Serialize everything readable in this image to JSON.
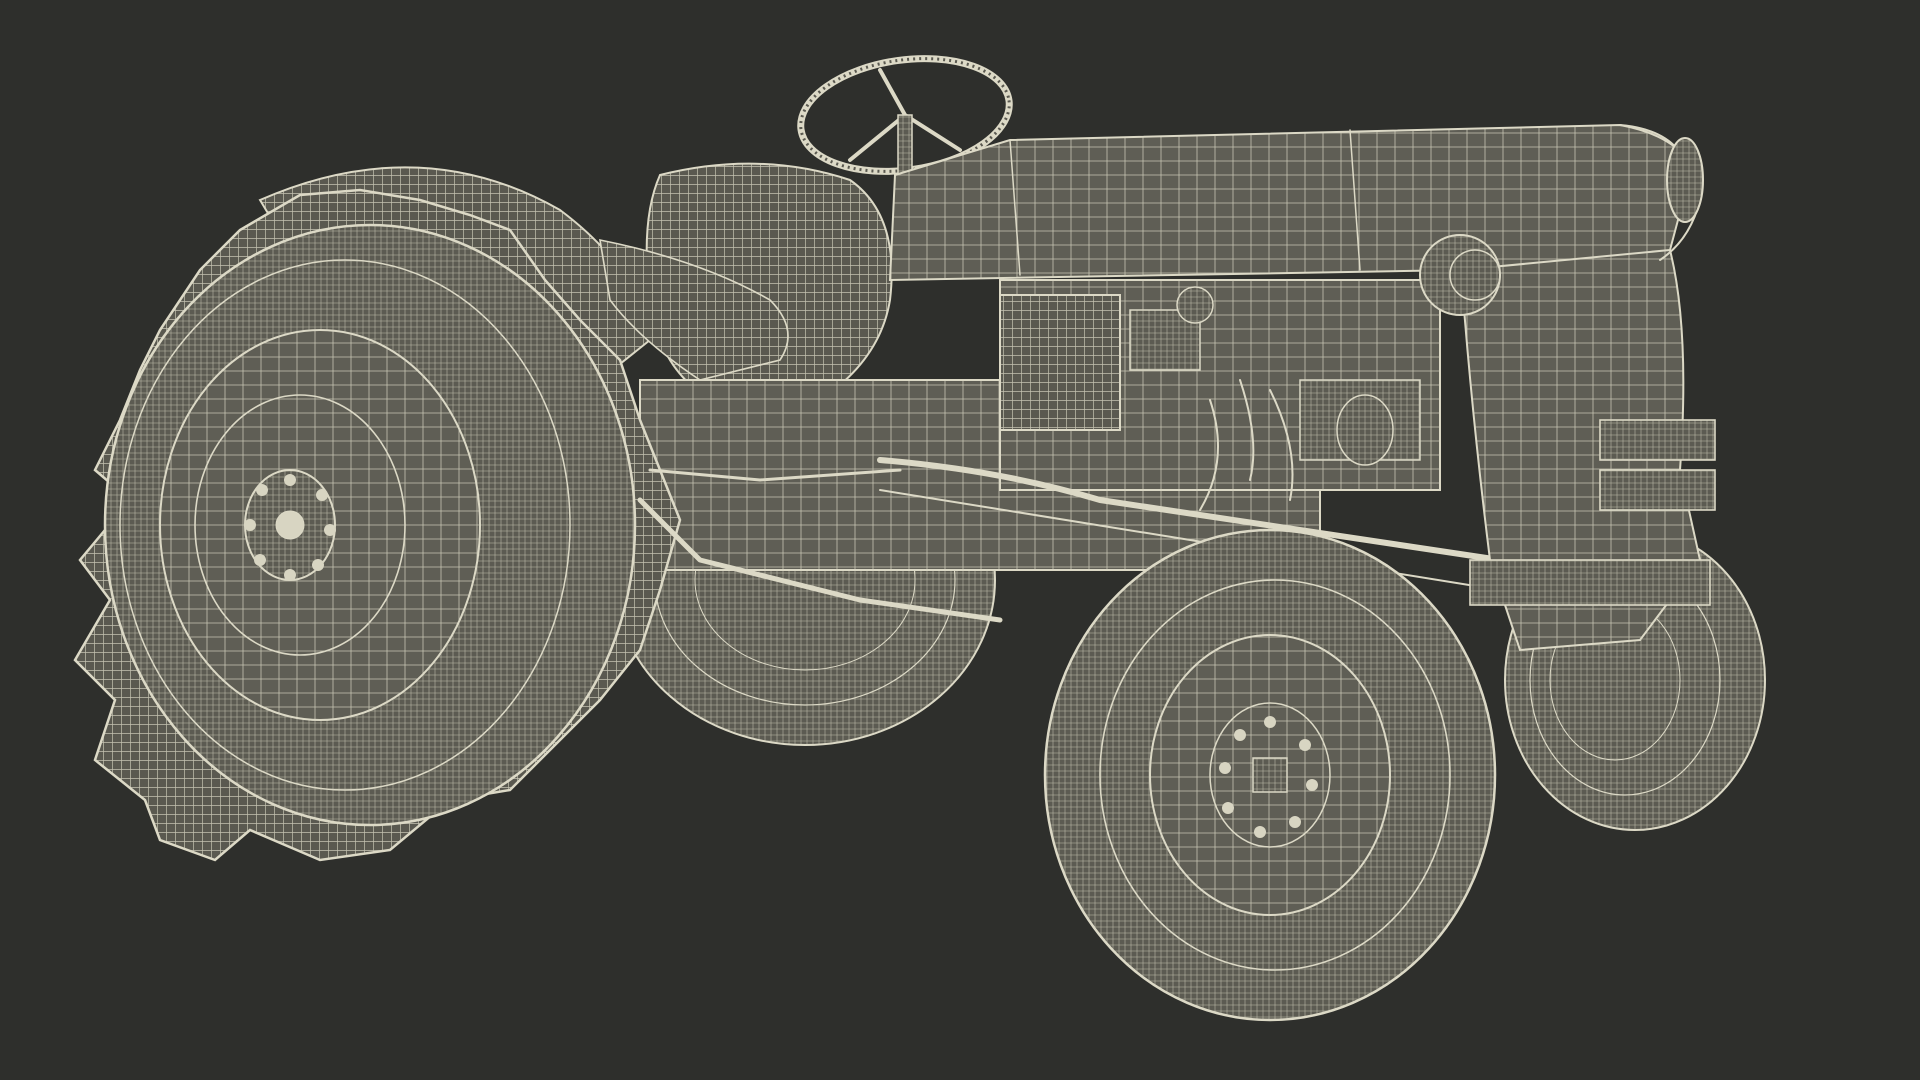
{
  "scene": {
    "subject": "tractor-wireframe",
    "background_color": "#2e2f2c",
    "surface_color": "#5e5d54",
    "wire_color": "#dcd9c6"
  }
}
